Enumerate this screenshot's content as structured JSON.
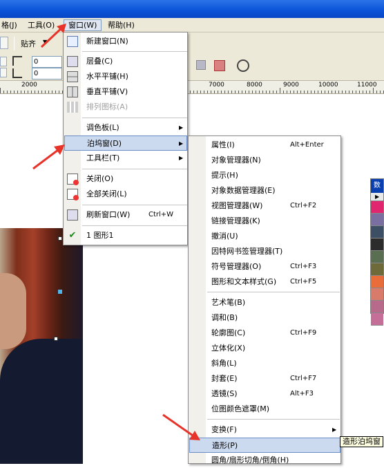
{
  "menubar": {
    "items": [
      {
        "label": "格(J)"
      },
      {
        "label": "工具(O)"
      },
      {
        "label": "窗口(W)"
      },
      {
        "label": "帮助(H)"
      }
    ]
  },
  "toolbar": {
    "snap_label": "贴齐",
    "spin1": "0",
    "spin2": "0"
  },
  "ruler": {
    "labels": [
      "2000",
      "7000",
      "8000",
      "9000",
      "10000",
      "11000"
    ]
  },
  "window_menu": {
    "items": [
      {
        "label": "新建窗口(N)",
        "icon": "new-window-icon"
      },
      {
        "label": "层叠(C)",
        "icon": "cascade-icon"
      },
      {
        "label": "水平平铺(H)",
        "icon": "tile-horizontal-icon"
      },
      {
        "label": "垂直平铺(V)",
        "icon": "tile-vertical-icon"
      },
      {
        "label": "排列图标(A)",
        "icon": "arrange-icons-icon",
        "disabled": true
      },
      {
        "label": "调色板(L)",
        "submenu": true
      },
      {
        "label": "泊坞窗(D)",
        "submenu": true,
        "highlighted": true
      },
      {
        "label": "工具栏(T)",
        "submenu": true
      },
      {
        "label": "关闭(O)",
        "icon": "close-doc-icon"
      },
      {
        "label": "全部关闭(L)",
        "icon": "close-all-icon"
      },
      {
        "label": "刷新窗口(W)",
        "shortcut": "Ctrl+W",
        "icon": "refresh-window-icon"
      },
      {
        "label": "1 图形1",
        "icon": "check-icon"
      }
    ]
  },
  "docker_menu": {
    "items": [
      {
        "label": "属性(I)",
        "shortcut": "Alt+Enter"
      },
      {
        "label": "对象管理器(N)"
      },
      {
        "label": "提示(H)"
      },
      {
        "label": "对象数据管理器(E)"
      },
      {
        "label": "视图管理器(W)",
        "shortcut": "Ctrl+F2"
      },
      {
        "label": "链接管理器(K)"
      },
      {
        "label": "撤消(U)"
      },
      {
        "label": "因特网书签管理器(T)"
      },
      {
        "label": "符号管理器(O)",
        "shortcut": "Ctrl+F3"
      },
      {
        "label": "图形和文本样式(G)",
        "shortcut": "Ctrl+F5"
      },
      {
        "label": "艺术笔(B)"
      },
      {
        "label": "调和(B)"
      },
      {
        "label": "轮廓图(C)",
        "shortcut": "Ctrl+F9"
      },
      {
        "label": "立体化(X)"
      },
      {
        "label": "斜角(L)"
      },
      {
        "label": "封套(E)",
        "shortcut": "Ctrl+F7"
      },
      {
        "label": "透镜(S)",
        "shortcut": "Alt+F3"
      },
      {
        "label": "位图颜色遮罩(M)"
      },
      {
        "label": "变换(F)",
        "submenu": true
      },
      {
        "label": "造形(P)",
        "highlighted": true
      },
      {
        "label": "圆角/扇形切角/倒角(H)"
      }
    ]
  },
  "palette": {
    "title": "数",
    "colors": [
      "#e0266f",
      "#7a6fa0",
      "#3c4f64",
      "#2c2c2c",
      "#5a6e52",
      "#6f6a3a",
      "#e86d3a",
      "#d97b6a",
      "#b86a8a",
      "#c56f98"
    ]
  },
  "tooltip": "造形泊坞窗",
  "colors": {
    "title_bar": "#0a52d8",
    "menu_highlight": "#ccdaf0",
    "arrow": "#e8332a"
  }
}
